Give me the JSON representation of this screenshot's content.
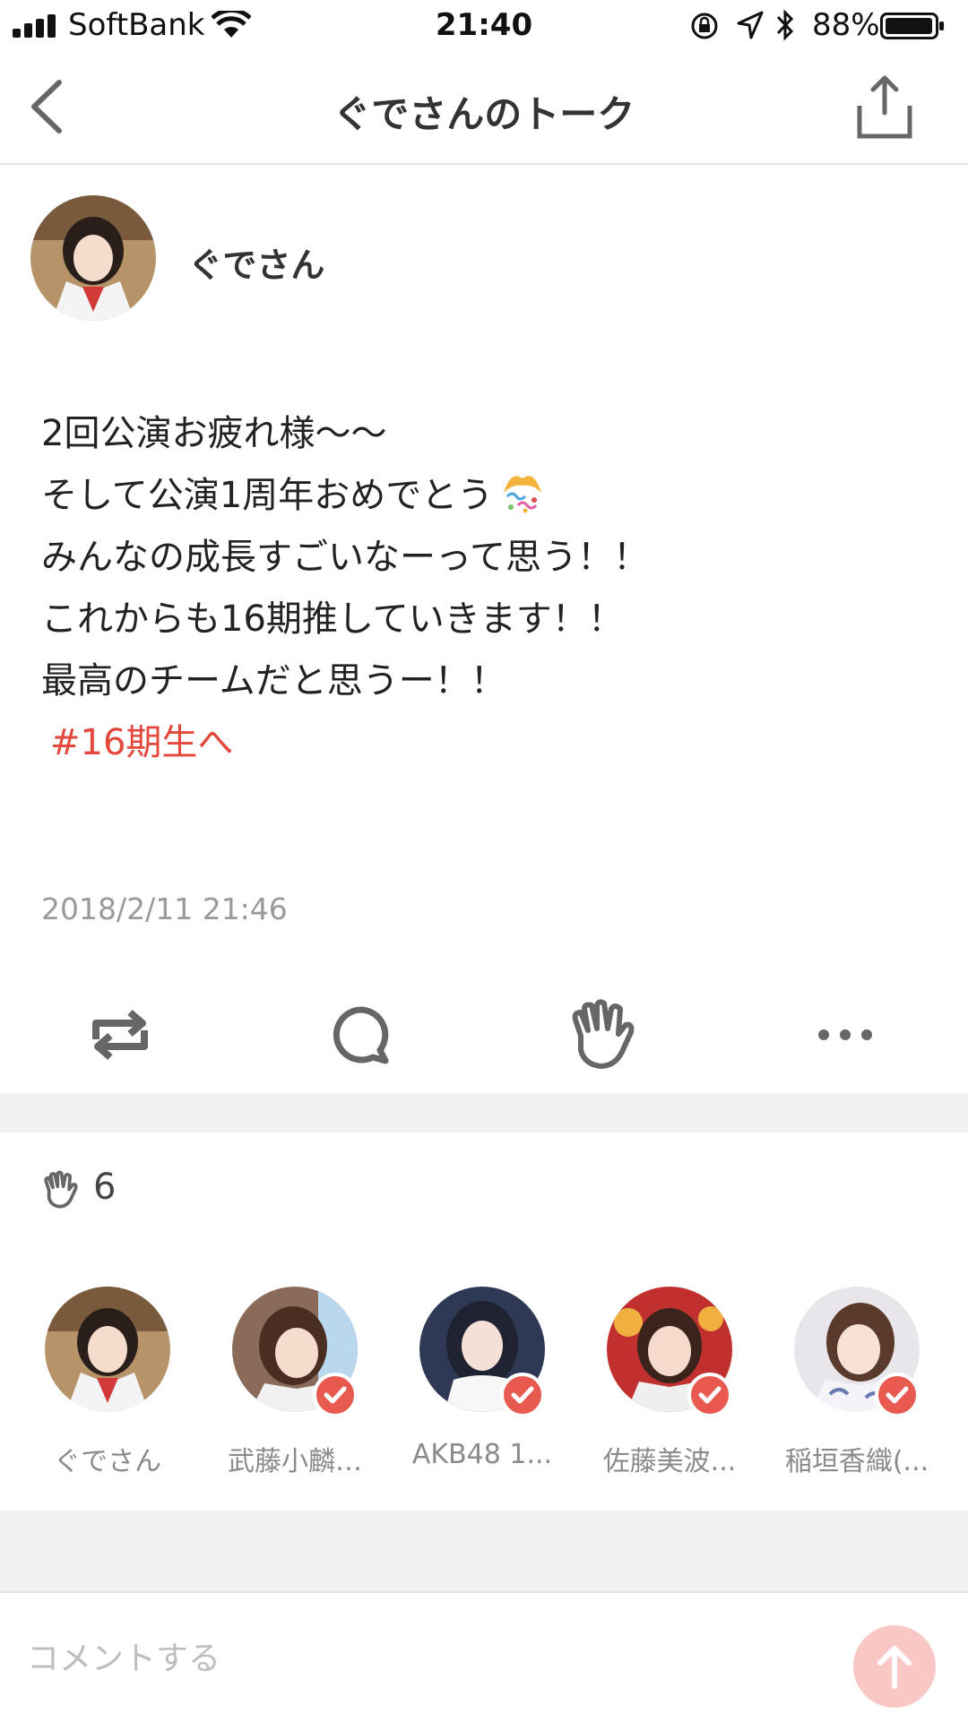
{
  "status_bar": {
    "carrier": "SoftBank",
    "time": "21:40",
    "battery": "88%"
  },
  "header": {
    "title": "ぐでさんのトーク",
    "back_icon": "chevron-left-icon",
    "share_icon": "share-icon"
  },
  "post": {
    "author": "ぐでさん",
    "lines": [
      "2回公演お疲れ様〜〜",
      "そして公演1周年おめでとう",
      "みんなの成長すごいなーって思う！！",
      "これからも16期推していきます！！",
      "最高のチームだと思うー！！"
    ],
    "emoji": "party-popper-icon",
    "hashtag": "#16期生へ",
    "timestamp": "2018/2/11 21:46"
  },
  "actions": [
    "repost-icon",
    "comment-icon",
    "clap-icon",
    "more-icon"
  ],
  "claps": {
    "count": "6",
    "members": [
      {
        "name": "ぐでさん",
        "verified": false
      },
      {
        "name": "武藤小麟…",
        "verified": true
      },
      {
        "name": "AKB48 1...",
        "verified": true
      },
      {
        "name": "佐藤美波...",
        "verified": true
      },
      {
        "name": "稲垣香織(...",
        "verified": true
      }
    ]
  },
  "comment": {
    "placeholder": "コメントする"
  },
  "colors": {
    "accent": "#e3483c",
    "send_button": "#f9c8c4",
    "divider": "#f1f1f1"
  }
}
